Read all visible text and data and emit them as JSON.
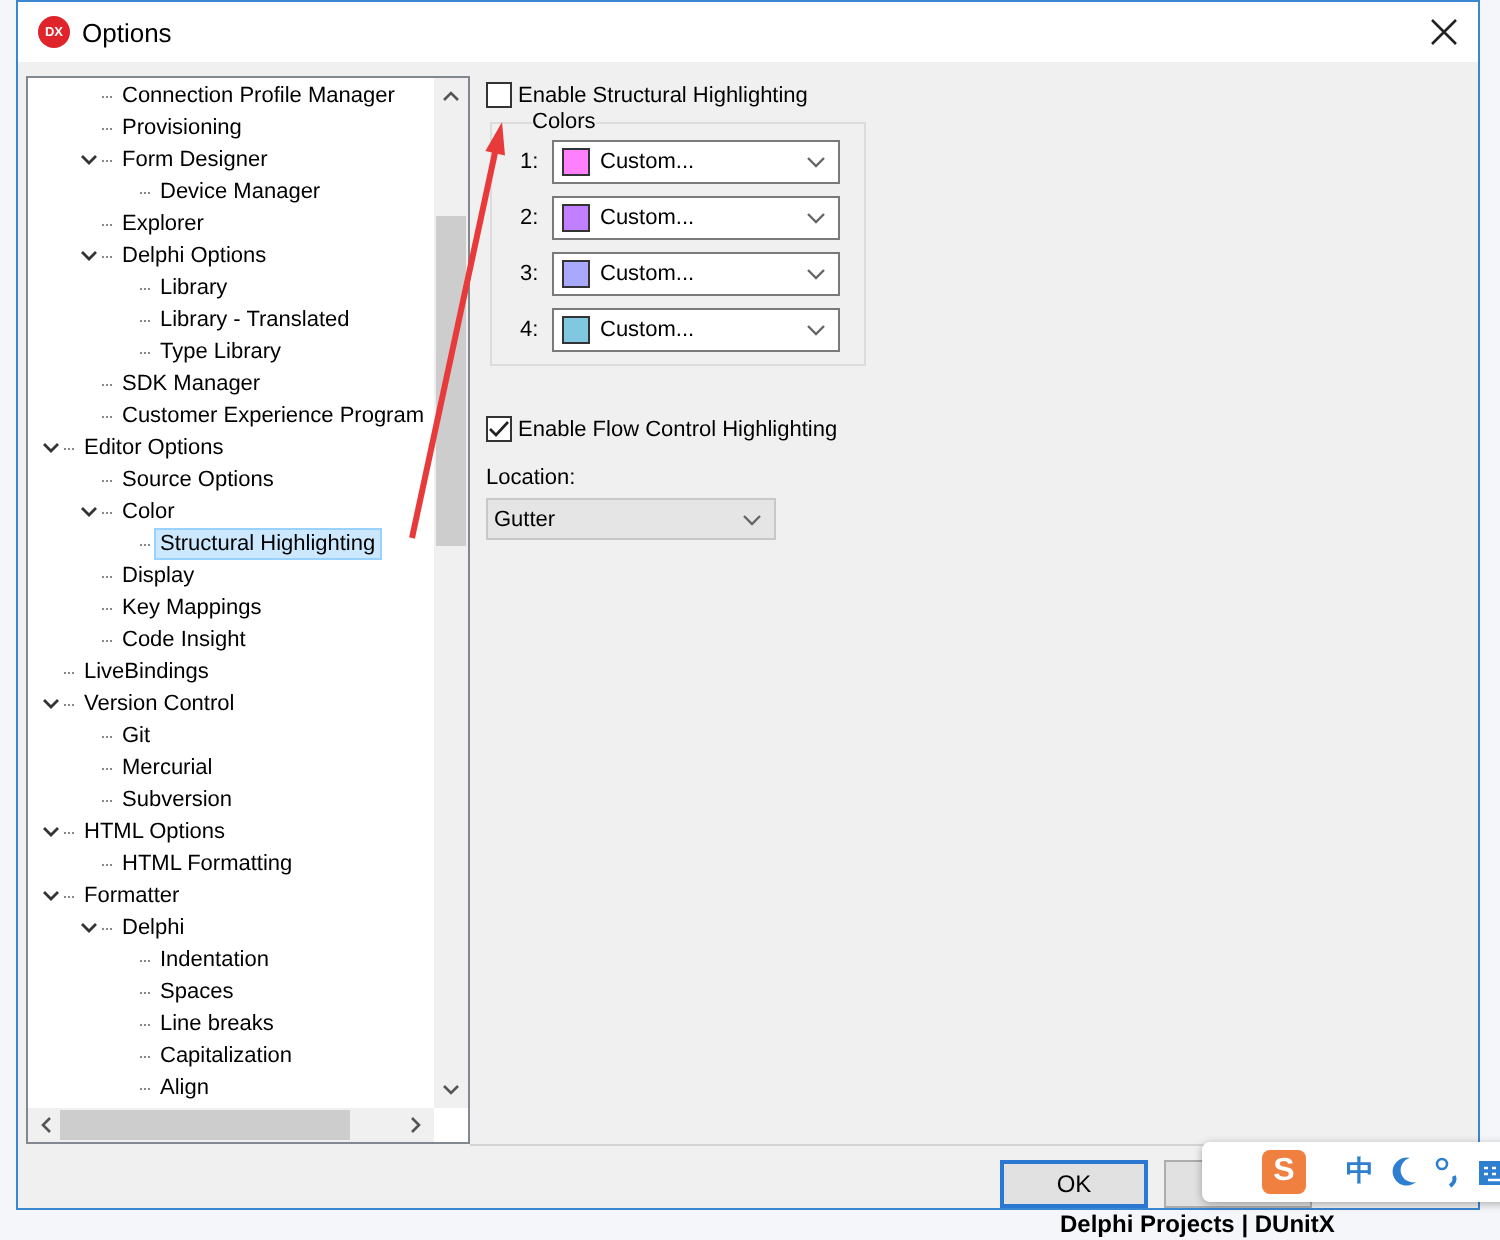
{
  "window": {
    "logo": "DX",
    "title": "Options"
  },
  "tree": {
    "items": [
      {
        "children": [
          {
            "label": "Connection Profile Manager",
            "selected": false
          },
          {
            "label": "Provisioning",
            "selected": false
          },
          {
            "label": "Form Designer",
            "expanded": true,
            "selected": false,
            "children": [
              {
                "label": "Device Manager",
                "selected": false
              }
            ]
          },
          {
            "label": "Explorer",
            "selected": false
          },
          {
            "label": "Delphi Options",
            "expanded": true,
            "selected": false,
            "children": [
              {
                "label": "Library",
                "selected": false
              },
              {
                "label": "Library - Translated",
                "selected": false
              },
              {
                "label": "Type Library",
                "selected": false
              }
            ]
          },
          {
            "label": "SDK Manager",
            "selected": false
          },
          {
            "label": "Customer Experience Program",
            "selected": false
          }
        ]
      },
      {
        "label": "Editor Options",
        "expanded": true,
        "selected": false,
        "children": [
          {
            "label": "Source Options",
            "selected": false
          },
          {
            "label": "Color",
            "expanded": true,
            "selected": false,
            "children": [
              {
                "label": "Structural Highlighting",
                "selected": true
              }
            ]
          },
          {
            "label": "Display",
            "selected": false
          },
          {
            "label": "Key Mappings",
            "selected": false
          },
          {
            "label": "Code Insight",
            "selected": false
          }
        ]
      },
      {
        "label": "LiveBindings",
        "selected": false
      },
      {
        "label": "Version Control",
        "expanded": true,
        "selected": false,
        "children": [
          {
            "label": "Git",
            "selected": false
          },
          {
            "label": "Mercurial",
            "selected": false
          },
          {
            "label": "Subversion",
            "selected": false
          }
        ]
      },
      {
        "label": "HTML Options",
        "expanded": true,
        "selected": false,
        "children": [
          {
            "label": "HTML Formatting",
            "selected": false
          }
        ]
      },
      {
        "label": "Formatter",
        "expanded": true,
        "selected": false,
        "children": [
          {
            "label": "Delphi",
            "expanded": true,
            "selected": false,
            "children": [
              {
                "label": "Indentation",
                "selected": false
              },
              {
                "label": "Spaces",
                "selected": false
              },
              {
                "label": "Line breaks",
                "selected": false
              },
              {
                "label": "Capitalization",
                "selected": false
              },
              {
                "label": "Align",
                "selected": false
              }
            ]
          }
        ]
      }
    ]
  },
  "structural": {
    "label": "Enable Structural Highlighting",
    "checked": false
  },
  "colors": {
    "title": "Colors",
    "rows": [
      {
        "number": "1:",
        "value": "Custom...",
        "color": "#ff80ff"
      },
      {
        "number": "2:",
        "value": "Custom...",
        "color": "#c080ff"
      },
      {
        "number": "3:",
        "value": "Custom...",
        "color": "#a8a8ff"
      },
      {
        "number": "4:",
        "value": "Custom...",
        "color": "#80c8e0"
      }
    ]
  },
  "flow": {
    "label": "Enable Flow Control Highlighting",
    "checked": true
  },
  "location": {
    "label": "Location:",
    "value": "Gutter"
  },
  "buttons": {
    "ok": "OK"
  },
  "ime_bar": {
    "logo": "S",
    "mode": "中"
  },
  "background": {
    "project_title": "Delphi Projects | DUnitX"
  }
}
